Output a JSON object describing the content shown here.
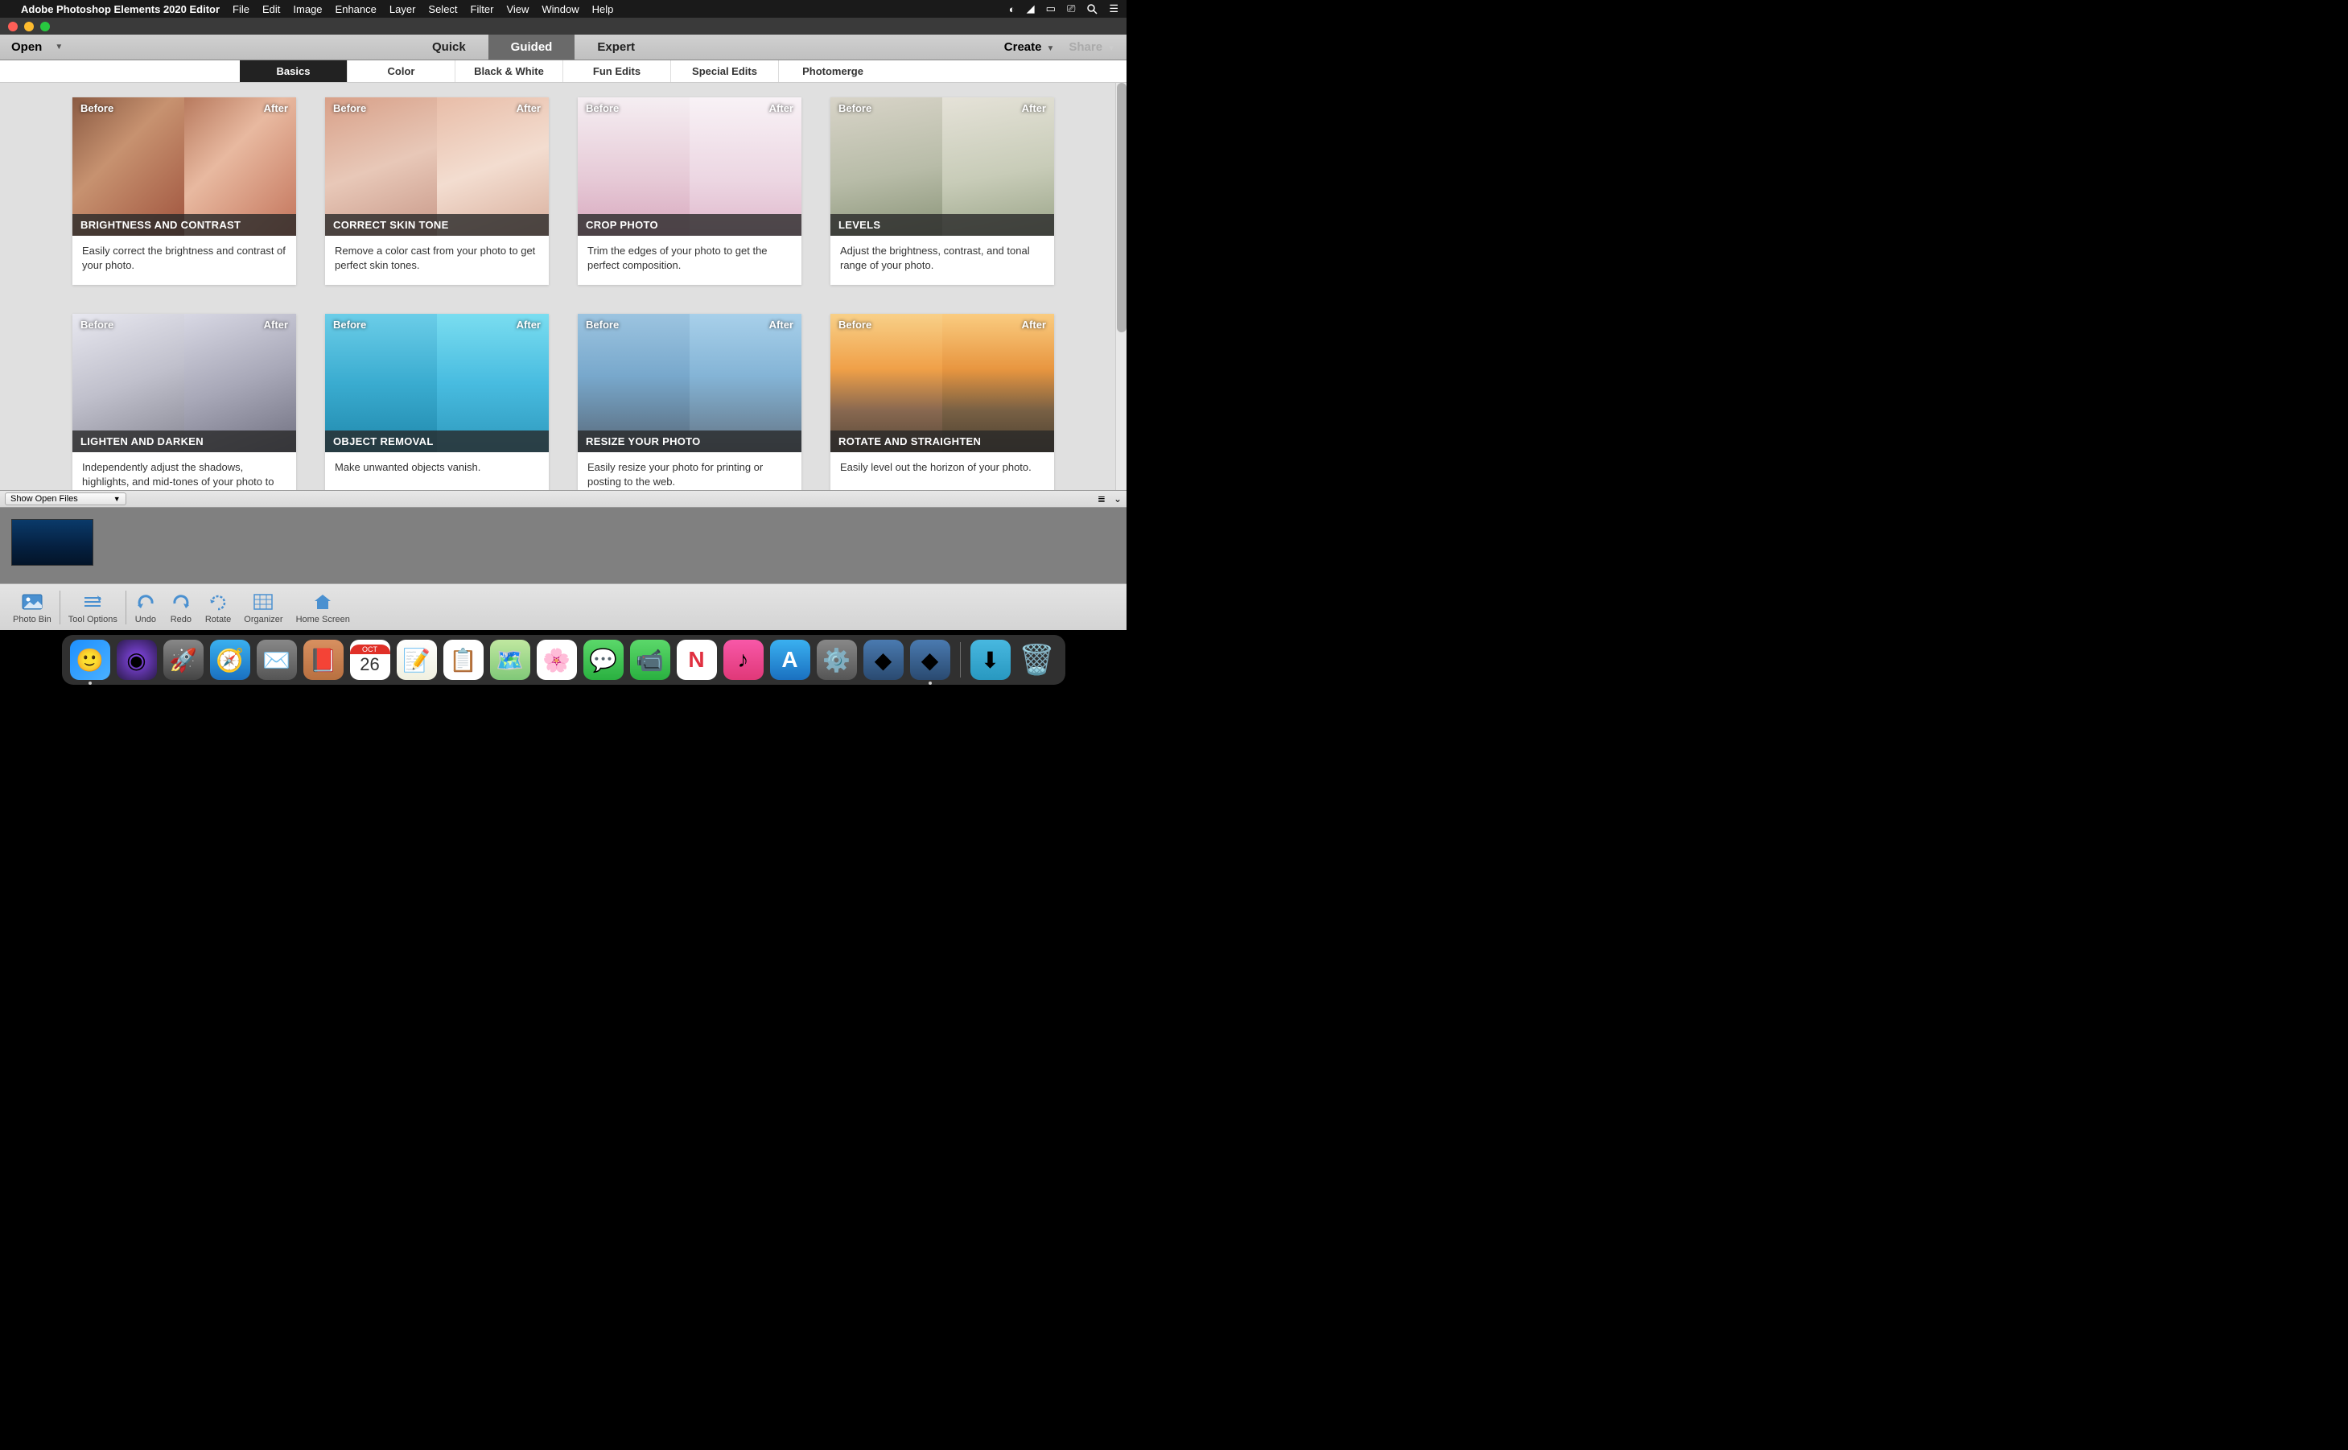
{
  "menubar": {
    "app_name": "Adobe Photoshop Elements 2020 Editor",
    "items": [
      "File",
      "Edit",
      "Image",
      "Enhance",
      "Layer",
      "Select",
      "Filter",
      "View",
      "Window",
      "Help"
    ]
  },
  "toolbar": {
    "open_label": "Open",
    "modes": {
      "quick": "Quick",
      "guided": "Guided",
      "expert": "Expert"
    },
    "create_label": "Create",
    "share_label": "Share"
  },
  "categories": {
    "basics": "Basics",
    "color": "Color",
    "bw": "Black & White",
    "fun": "Fun Edits",
    "special": "Special Edits",
    "photomerge": "Photomerge"
  },
  "labels": {
    "before": "Before",
    "after": "After"
  },
  "cards": [
    {
      "title": "BRIGHTNESS AND CONTRAST",
      "desc": "Easily correct the brightness and contrast of your photo."
    },
    {
      "title": "CORRECT SKIN TONE",
      "desc": "Remove a color cast from your photo to get perfect skin tones."
    },
    {
      "title": "CROP PHOTO",
      "desc": "Trim the edges of your photo to get the perfect composition."
    },
    {
      "title": "LEVELS",
      "desc": "Adjust the brightness, contrast, and tonal range of your photo."
    },
    {
      "title": "LIGHTEN AND DARKEN",
      "desc": "Independently adjust the shadows, highlights, and mid-tones of your photo to get the"
    },
    {
      "title": "OBJECT REMOVAL",
      "desc": "Make unwanted objects vanish."
    },
    {
      "title": "RESIZE YOUR PHOTO",
      "desc": "Easily resize your photo for printing or posting to the web."
    },
    {
      "title": "ROTATE AND STRAIGHTEN",
      "desc": "Easily level out the horizon of your photo."
    }
  ],
  "bin": {
    "select_label": "Show Open Files"
  },
  "bottom_tools": {
    "photo_bin": "Photo Bin",
    "tool_options": "Tool Options",
    "undo": "Undo",
    "redo": "Redo",
    "rotate": "Rotate",
    "organizer": "Organizer",
    "home": "Home Screen"
  },
  "calendar": {
    "month": "OCT",
    "day": "26"
  }
}
